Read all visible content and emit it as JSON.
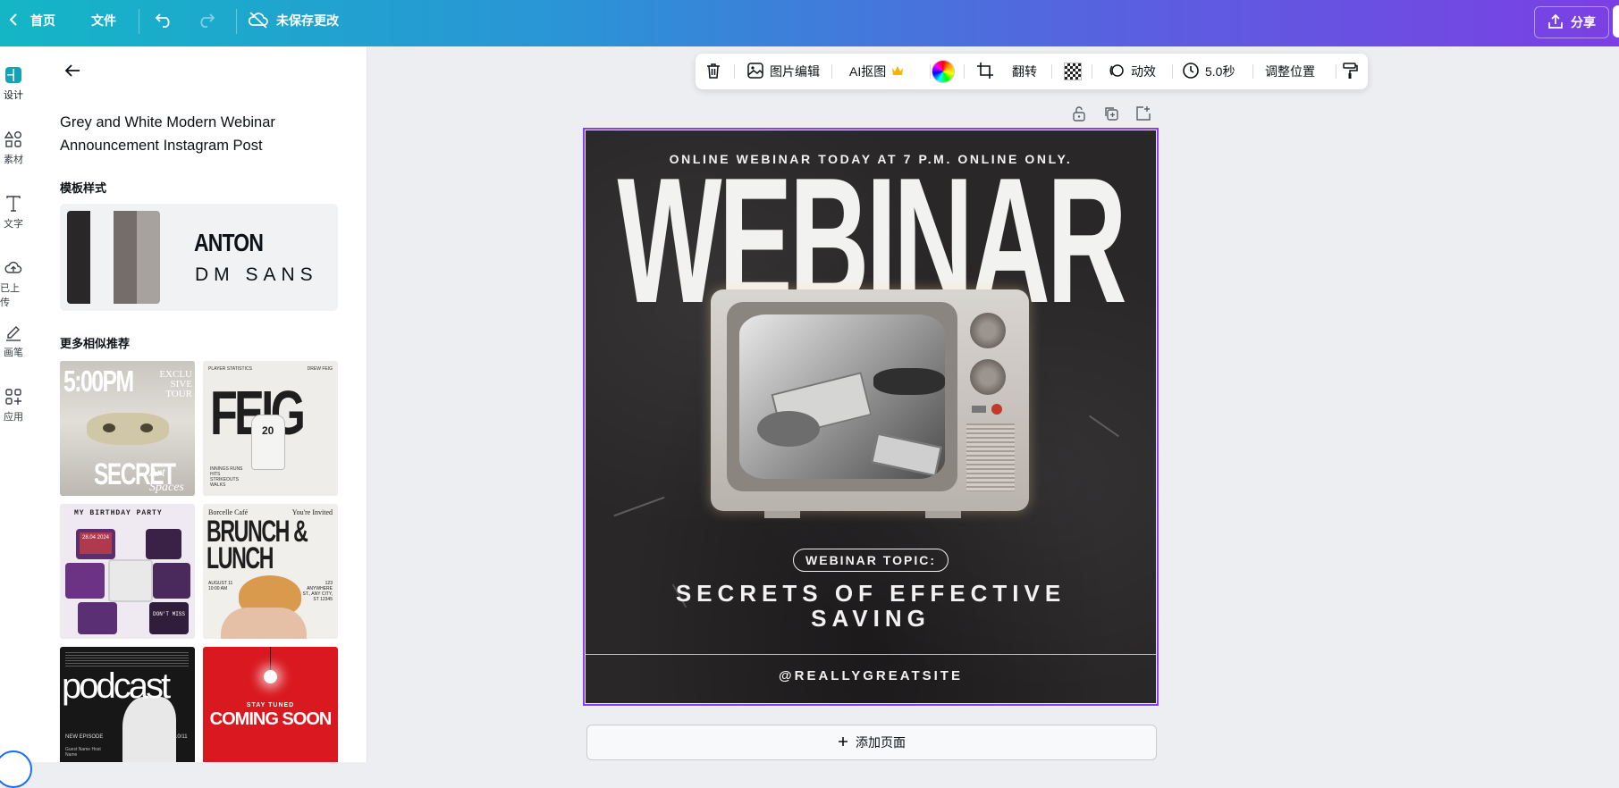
{
  "topbar": {
    "home_label": "首页",
    "file_label": "文件",
    "unsaved_label": "未保存更改",
    "share_label": "分享"
  },
  "rail": {
    "items": [
      {
        "label": "设计",
        "icon": "design-icon"
      },
      {
        "label": "素材",
        "icon": "elements-icon"
      },
      {
        "label": "文字",
        "icon": "text-icon"
      },
      {
        "label": "已上传",
        "icon": "upload-cloud-icon"
      },
      {
        "label": "画笔",
        "icon": "draw-icon"
      },
      {
        "label": "应用",
        "icon": "apps-icon"
      }
    ]
  },
  "panel": {
    "template_title": "Grey and White Modern Webinar Announcement Instagram Post",
    "style_section_label": "模板样式",
    "heading_font": "ANTON",
    "body_font": "DM SANS",
    "swatch_colors": [
      "#2a2729",
      "#f1f2f4",
      "#756d6a",
      "#a8a29f"
    ],
    "more_section_label": "更多相似推荐",
    "thumbs": [
      {
        "big_text": "5:00PM",
        "small_text": "EXCLU SIVE TOUR",
        "bottom_text": "SECRET",
        "script_text": "Art Spaces"
      },
      {
        "top_left": "PLAYER STATISTICS",
        "top_right": "DREW FEIG",
        "big_text": "FEIG",
        "jersey": "20",
        "stats": "INNINGS RUNS HITS STRIKEOUTS WALKS"
      },
      {
        "title": "MY BIRTHDAY PARTY",
        "date": "28.04 2024",
        "tag": "DON'T MISS"
      },
      {
        "brand": "Borcelle Café",
        "invite": "You're Invited",
        "big_text": "BRUNCH & LUNCH",
        "date": "AUGUST 11 10:00 AM",
        "address": "123 ANYWHERE ST., ANY CITY, ST 12345"
      },
      {
        "big_text": "podcast",
        "episode": "NEW EPISODE",
        "number": "10/11",
        "caption": "Guest Name Host Name"
      },
      {
        "top": "STAY TUNED",
        "big_text": "COMING SOON"
      }
    ]
  },
  "toolbar": {
    "edit_image_label": "图片编辑",
    "ai_cutout_label": "AI抠图",
    "flip_label": "翻转",
    "animate_label": "动效",
    "duration_label": "5.0秒",
    "position_label": "调整位置"
  },
  "design": {
    "top_line": "ONLINE WEBINAR TODAY AT 7 P.M. ONLINE ONLY.",
    "headline": "WEBINAR",
    "topic_label": "WEBINAR TOPIC:",
    "topic_line1": "SECRETS OF EFFECTIVE",
    "topic_line2": "SAVING",
    "handle": "@REALLYGREATSITE"
  },
  "canvas": {
    "add_page_label": "添加页面"
  },
  "colors": {
    "accent_purple": "#8b3dff",
    "crown_gold": "#f5b400"
  }
}
